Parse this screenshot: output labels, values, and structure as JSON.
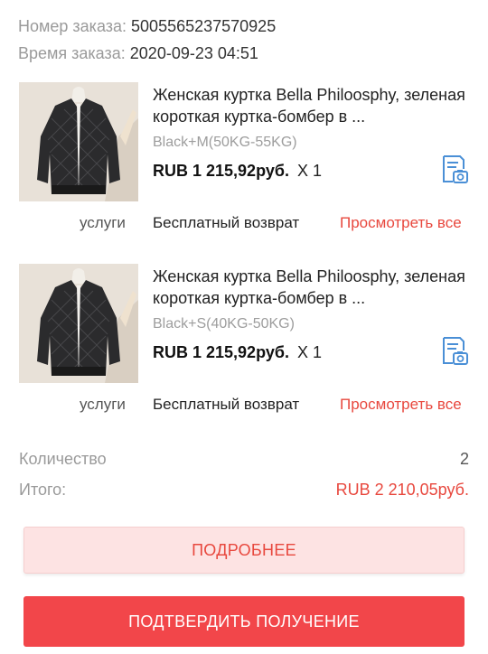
{
  "order": {
    "number_label": "Номер заказа:",
    "number_value": "5005565237570925",
    "time_label": "Время заказа:",
    "time_value": "2020-09-23 04:51"
  },
  "items": [
    {
      "title": "Женская куртка Bella Philoosphy, зеленая короткая куртка-бомбер в ...",
      "variant": "Black+M(50KG-55KG)",
      "price": "RUB 1 215,92руб.",
      "quantity": "X 1",
      "photo_icon": "photo-review-icon",
      "services_label": "услуги",
      "services_value": "Бесплатный возврат",
      "view_all": "Просмотреть все"
    },
    {
      "title": "Женская куртка Bella Philoosphy, зеленая короткая куртка-бомбер в ...",
      "variant": "Black+S(40KG-50KG)",
      "price": "RUB 1 215,92руб.",
      "quantity": "X 1",
      "photo_icon": "photo-review-icon",
      "services_label": "услуги",
      "services_value": "Бесплатный возврат",
      "view_all": "Просмотреть все"
    }
  ],
  "summary": {
    "quantity_label": "Количество",
    "quantity_value": "2",
    "total_label": "Итого:",
    "total_value": "RUB 2 210,05руб."
  },
  "buttons": {
    "details": "ПОДРОБНЕЕ",
    "confirm": "ПОДТВЕРДИТЬ ПОЛУЧЕНИЕ"
  },
  "colors": {
    "accent": "#e8483e",
    "confirm_bg": "#f2464a",
    "details_bg": "#fde3e3",
    "icon_blue": "#4a8fd6"
  }
}
